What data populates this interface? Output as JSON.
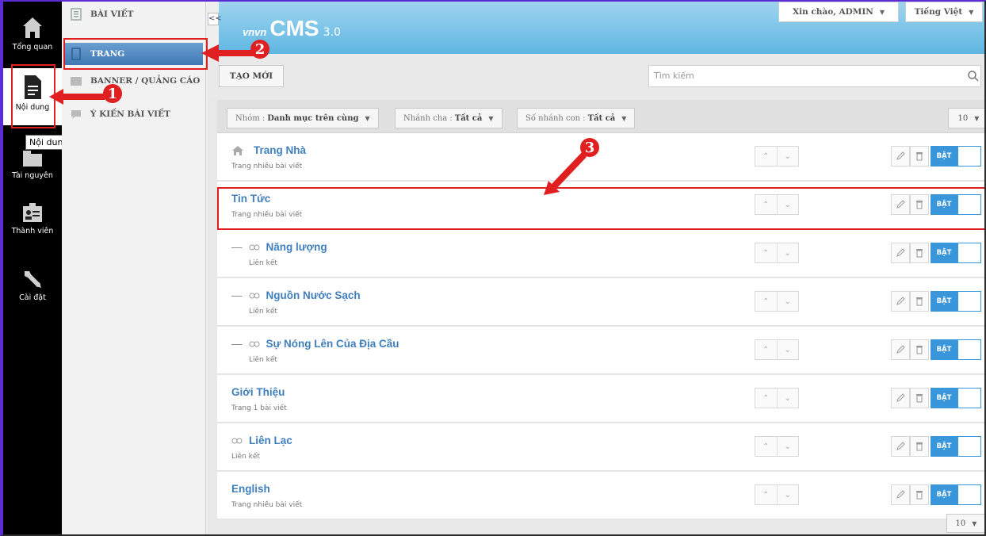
{
  "rail": {
    "items": [
      {
        "label": "Tổng quan",
        "icon": "home-icon"
      },
      {
        "label": "Nội dung",
        "icon": "document-icon"
      },
      {
        "label": "Tài nguyên",
        "icon": "folder-icon"
      },
      {
        "label": "Thành viên",
        "icon": "members-icon"
      },
      {
        "label": "Cài đặt",
        "icon": "wrench-icon"
      }
    ],
    "tooltip": "Nội dung"
  },
  "submenu": {
    "items": [
      {
        "label": "BÀI VIẾT",
        "icon": "articles-icon"
      },
      {
        "label": "TRANG",
        "icon": "page-icon"
      },
      {
        "label": "BANNER / QUẢNG CÁO",
        "icon": "banner-icon"
      },
      {
        "label": "Ý KIẾN BÀI VIẾT",
        "icon": "comment-icon"
      }
    ]
  },
  "header": {
    "collapse": "<<",
    "logo_small": "vnvn",
    "logo_main": "CMS",
    "logo_version": "3.0",
    "greeting": "Xin chào, ADMIN",
    "language": "Tiếng Việt"
  },
  "toolbar": {
    "new_label": "TẠO MỚI",
    "search_placeholder": "Tìm kiếm"
  },
  "filters": {
    "group_label": "Nhóm :",
    "group_value": "Danh mục trên cùng",
    "parent_label": "Nhánh cha :",
    "parent_value": "Tất cả",
    "children_label": "Số nhánh con :",
    "children_value": "Tất cả",
    "page_size": "10"
  },
  "rows": [
    {
      "title": "Trang Nhà",
      "subtitle": "Trang nhiều bài viết",
      "toggle": "BẬT"
    },
    {
      "title": "Tin Tức",
      "subtitle": "Trang nhiều bài viết",
      "toggle": "BẬT"
    },
    {
      "title": "Năng lượng",
      "subtitle": "Liên kết",
      "toggle": "BẬT"
    },
    {
      "title": "Nguồn Nước Sạch",
      "subtitle": "Liên kết",
      "toggle": "BẬT"
    },
    {
      "title": "Sự Nóng Lên Của Địa Cầu",
      "subtitle": "Liên kết",
      "toggle": "BẬT"
    },
    {
      "title": "Giới Thiệu",
      "subtitle": "Trang 1 bài viết",
      "toggle": "BẬT"
    },
    {
      "title": "Liên Lạc",
      "subtitle": "Liên kết",
      "toggle": "BẬT"
    },
    {
      "title": "English",
      "subtitle": "Trang nhiều bài viết",
      "toggle": "BẬT"
    }
  ],
  "footer": {
    "page_size": "10"
  },
  "annotations": {
    "step1": "1",
    "step2": "2",
    "step3": "3"
  },
  "colors": {
    "highlight": "#e02020",
    "accent": "#3a96db",
    "title": "#3f7fbd"
  }
}
